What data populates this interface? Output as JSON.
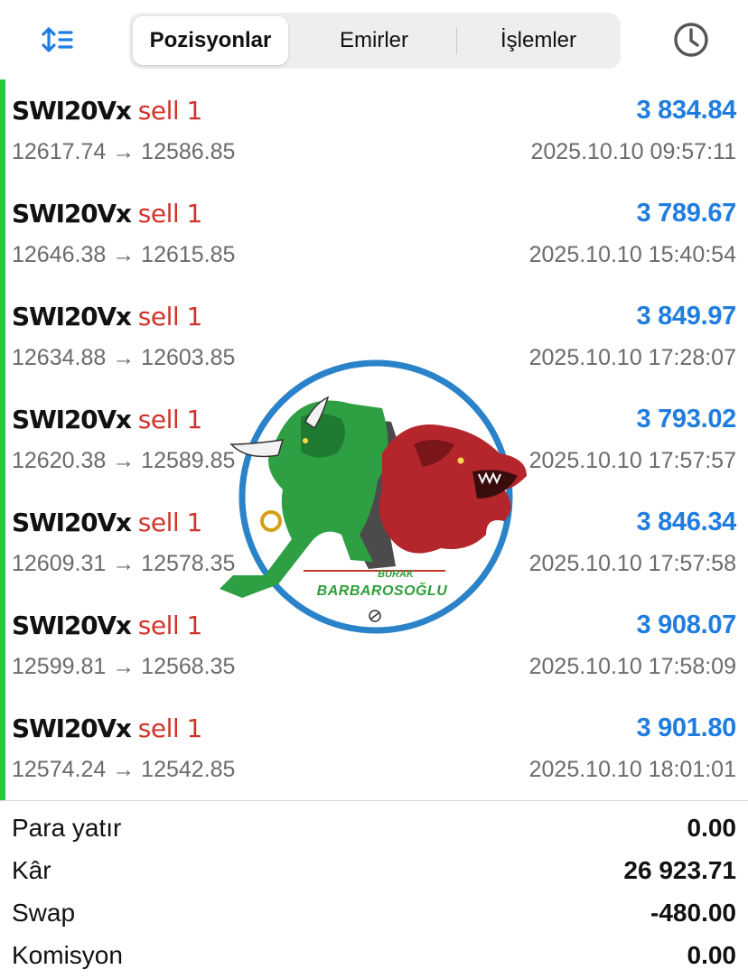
{
  "toolbar": {
    "sort_icon": "sort-icon",
    "history_icon": "clock-icon",
    "tabs": [
      {
        "label": "Pozisyonlar",
        "active": true
      },
      {
        "label": "Emirler",
        "active": false
      },
      {
        "label": "İşlemler",
        "active": false
      }
    ]
  },
  "positions": [
    {
      "symbol": "SWI20Vx",
      "side": "sell 1",
      "profit": "3 834.84",
      "prices": "12617.74 → 12586.85",
      "time": "2025.10.10 09:57:11"
    },
    {
      "symbol": "SWI20Vx",
      "side": "sell 1",
      "profit": "3 789.67",
      "prices": "12646.38 → 12615.85",
      "time": "2025.10.10 15:40:54"
    },
    {
      "symbol": "SWI20Vx",
      "side": "sell 1",
      "profit": "3 849.97",
      "prices": "12634.88 → 12603.85",
      "time": "2025.10.10 17:28:07"
    },
    {
      "symbol": "SWI20Vx",
      "side": "sell 1",
      "profit": "3 793.02",
      "prices": "12620.38 → 12589.85",
      "time": "2025.10.10 17:57:57"
    },
    {
      "symbol": "SWI20Vx",
      "side": "sell 1",
      "profit": "3 846.34",
      "prices": "12609.31 → 12578.35",
      "time": "2025.10.10 17:57:58"
    },
    {
      "symbol": "SWI20Vx",
      "side": "sell 1",
      "profit": "3 908.07",
      "prices": "12599.81 → 12568.35",
      "time": "2025.10.10 17:58:09"
    },
    {
      "symbol": "SWI20Vx",
      "side": "sell 1",
      "profit": "3 901.80",
      "prices": "12574.24 → 12542.85",
      "time": "2025.10.10 18:01:01"
    }
  ],
  "watermark": {
    "line1": "BURAK",
    "line2": "BARBAROSOĞLU"
  },
  "summary": [
    {
      "label": "Para yatır",
      "value": "0.00"
    },
    {
      "label": "Kâr",
      "value": "26 923.71"
    },
    {
      "label": "Swap",
      "value": "-480.00"
    },
    {
      "label": "Komisyon",
      "value": "0.00"
    }
  ],
  "colors": {
    "profit": "#1f7de0",
    "sell": "#d2332a",
    "position_bar": "#27c93f",
    "icon_blue": "#1f7de0"
  }
}
